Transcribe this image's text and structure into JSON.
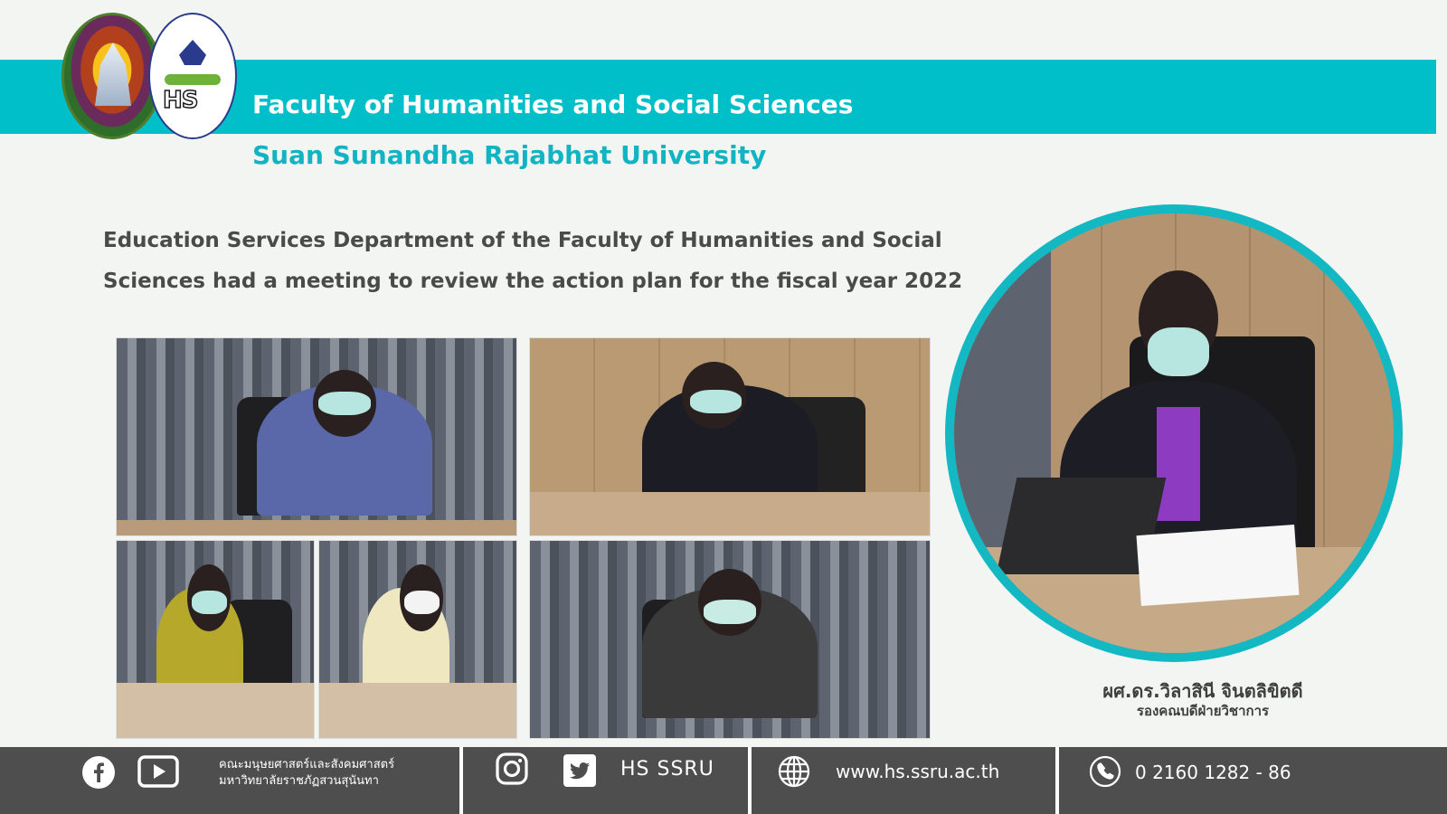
{
  "header": {
    "faculty_name": "Faculty of Humanities and Social Sciences",
    "university_name": "Suan Sunandha Rajabhat University",
    "logo_hs_text": "HS"
  },
  "headline": {
    "line_1": "Education Services Department of the Faculty of Humanities and Social",
    "line_2": "Sciences had a meeting to review the action plan for the fiscal year 2022"
  },
  "featured_person": {
    "name": "ผศ.ดร.วิลาสินี จินตลิขิตดี",
    "position": "รองคณบดีฝ่ายวิชาการ"
  },
  "footer": {
    "faculty_thai_line_1": "คณะมนุษยศาสตร์และสังคมศาสตร์",
    "faculty_thai_line_2": "มหาวิทยาลัยราชภัฏสวนสุนันทา",
    "social_handle": "HS SSRU",
    "website": "www.hs.ssru.ac.th",
    "phone": "0  2160 1282 - 86",
    "icons": [
      "facebook-icon",
      "youtube-icon",
      "instagram-icon",
      "twitter-icon",
      "globe-icon",
      "phone-icon"
    ]
  },
  "colors": {
    "banner": "#00bfc9",
    "university_text": "#12b4c3",
    "footer": "#4e4e4e"
  }
}
